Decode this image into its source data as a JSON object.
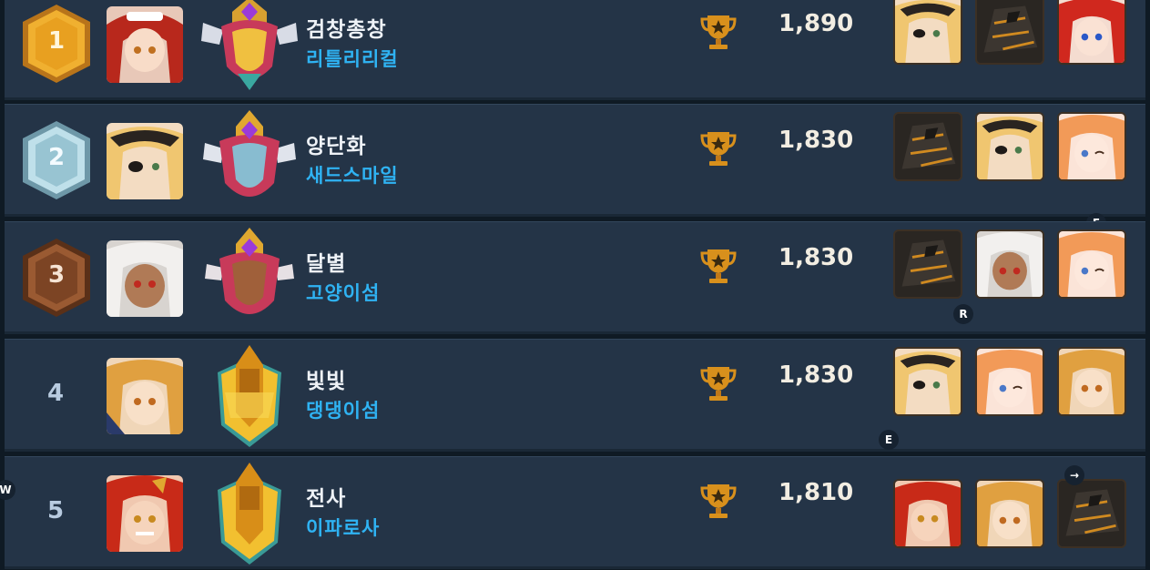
{
  "rows": [
    {
      "rank": "1",
      "name": "검창총창",
      "guild": "리틀리리컬",
      "score": "1,890",
      "portrait": "red-haired-maid-portrait",
      "team": [
        "eyepatch-blonde-hero",
        "dark-armor-hero",
        "red-haired-hero"
      ]
    },
    {
      "rank": "2",
      "name": "양단화",
      "guild": "새드스마일",
      "score": "1,830",
      "portrait": "eyepatch-blonde-portrait",
      "team": [
        "dark-armor-hero",
        "eyepatch-blonde-hero",
        "orange-haired-wink-hero"
      ]
    },
    {
      "rank": "3",
      "name": "달별",
      "guild": "고양이섬",
      "score": "1,830",
      "portrait": "white-haired-portrait",
      "team": [
        "dark-armor-hero",
        "white-haired-hero",
        "orange-haired-wink-hero"
      ]
    },
    {
      "rank": "4",
      "name": "빛빛",
      "guild": "댕댕이섬",
      "score": "1,830",
      "portrait": "golden-haired-portrait",
      "team": [
        "eyepatch-blonde-hero",
        "orange-haired-wink-hero",
        "golden-haired-hero"
      ]
    },
    {
      "rank": "5",
      "name": "전사",
      "guild": "이파로사",
      "score": "1,810",
      "portrait": "red-haired-grin-portrait",
      "team": [
        "red-haired-grin-hero",
        "golden-haired-hero",
        "dark-armor-hero"
      ]
    }
  ],
  "key_hints": {
    "f": "F",
    "r": "R",
    "e": "E",
    "w": "W",
    "arrow": "→"
  },
  "colors": {
    "row_bg": "#243447",
    "name": "#eef2f7",
    "guild": "#2fb3f3",
    "score": "#f2ede2",
    "gold": "#f0b030",
    "silver": "#9cc6d4",
    "bronze": "#8a4f2c"
  }
}
